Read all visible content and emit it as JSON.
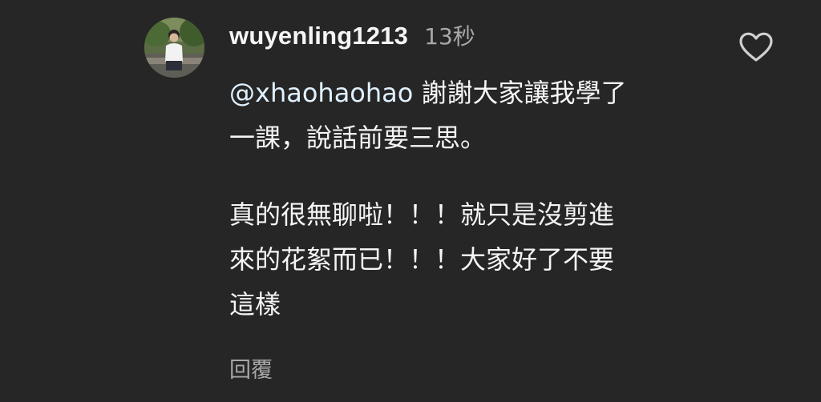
{
  "comment": {
    "username": "wuyenling1213",
    "timestamp": "13秒",
    "mention": "@xhaohaohao",
    "paragraph1_text": " 謝謝大家讓我學了\n一課，說話前要三思。",
    "paragraph2_text": "真的很無聊啦！！！就只是沒剪進\n來的花絮而已！！！大家好了不要\n這樣",
    "reply_label": "回覆"
  },
  "icons": {
    "like": "heart-outline-icon",
    "avatar": "profile-photo"
  },
  "colors": {
    "background": "#262626",
    "primary_text": "#f5f5f5",
    "secondary_text": "#a8a8a8",
    "mention": "#e0f1ff"
  }
}
